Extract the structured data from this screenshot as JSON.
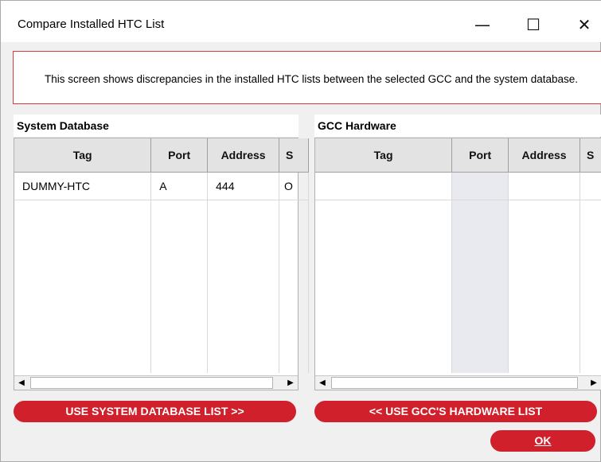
{
  "window": {
    "title": "Compare Installed HTC List"
  },
  "titlebar": {
    "minimize_glyph": "—",
    "maximize_glyph": "☐",
    "close_glyph": "✕"
  },
  "banner": {
    "text": "This screen shows discrepancies in the installed HTC lists between the selected GCC and the system database."
  },
  "system_panel": {
    "header": "System Database",
    "columns": [
      "Tag",
      "Port",
      "Address",
      "S"
    ],
    "rows": [
      {
        "tag": "DUMMY-HTC",
        "port": "A",
        "address": "444",
        "s": "O"
      }
    ]
  },
  "gcc_panel": {
    "header": "GCC Hardware",
    "columns": [
      "Tag",
      "Port",
      "Address",
      "S"
    ],
    "rows": []
  },
  "buttons": {
    "use_system": "USE SYSTEM DATABASE LIST >>",
    "use_gcc": "<< USE GCC'S HARDWARE LIST",
    "ok": "OK"
  },
  "colors": {
    "accent_red": "#d0202b",
    "banner_border": "#d63a3a"
  },
  "icons": [
    "minimize-icon",
    "maximize-icon",
    "close-icon",
    "scroll-left-icon",
    "scroll-right-icon"
  ]
}
